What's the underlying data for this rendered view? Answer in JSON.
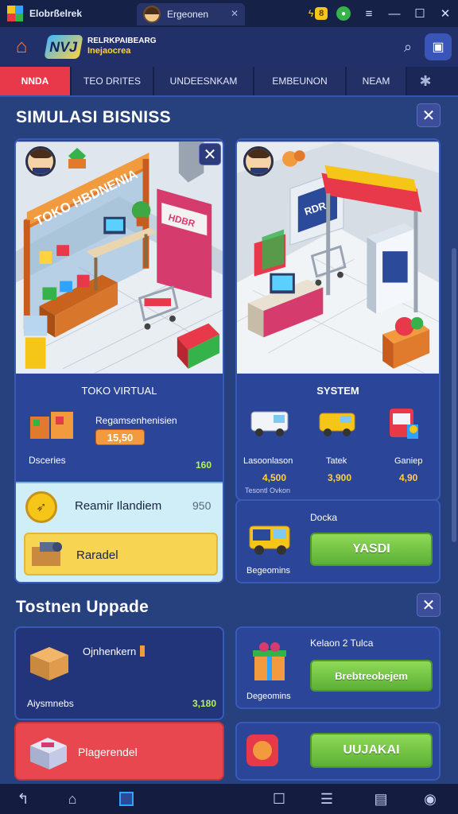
{
  "titlebar": {
    "app_name": "Elobrßelrek",
    "tab_label": "Ergeonen",
    "coin_label": "8"
  },
  "header": {
    "logo_mark": "NVJ",
    "logo_line1": "RELRKPAIBEARG",
    "logo_line2": "Inejaocrea"
  },
  "nav": {
    "tabs": [
      "NNDA",
      "TEO  DRITES",
      "UNDEESNKAM",
      "EMBEUNON",
      "NEAM"
    ]
  },
  "section1": {
    "title": "SIMULASI BISNISS",
    "left_card": {
      "scene_sign": "TOKO HBDNENIA",
      "scene_side_sign": "HDBR",
      "title": "TOKO VIRTUAL",
      "product_label": "Regamsenhenisien",
      "price_badge": "15,50",
      "stat_label": "Dsceries",
      "stat_value": "160",
      "reward_label": "Reamir Ilandiem",
      "reward_value": "950",
      "action_label": "Raradel"
    },
    "right_card": {
      "scene_sign": "RDR",
      "title": "SYSTEM",
      "vehicles": [
        {
          "label": "Lasoonlason",
          "price": "4,500"
        },
        {
          "label": "Tatek",
          "price": "3,900"
        },
        {
          "label": "Ganiep",
          "price": "4,90"
        }
      ],
      "vehicles_note": "Tesontl Ovkon",
      "delivery_label": "Docka",
      "delivery_sub": "Begeomins",
      "delivery_button": "YASDI"
    }
  },
  "section2": {
    "title": "Tostnen Uppade",
    "left_card1": {
      "label": "Ojnhenkern",
      "sub": "Aiysmnebs",
      "value": "3,180"
    },
    "left_card2": {
      "label": "Plagerendel"
    },
    "right_card1": {
      "label": "Kelaon 2 Tulca",
      "sub": "Degeomins",
      "button": "Brebtreobejem"
    },
    "right_card2": {
      "button": "UUJAKAI"
    }
  },
  "colors": {
    "accent_red": "#e8394a",
    "button_green": "#6cc23f",
    "panel_blue": "#2b4699",
    "price_yellow": "#ffd23f"
  }
}
